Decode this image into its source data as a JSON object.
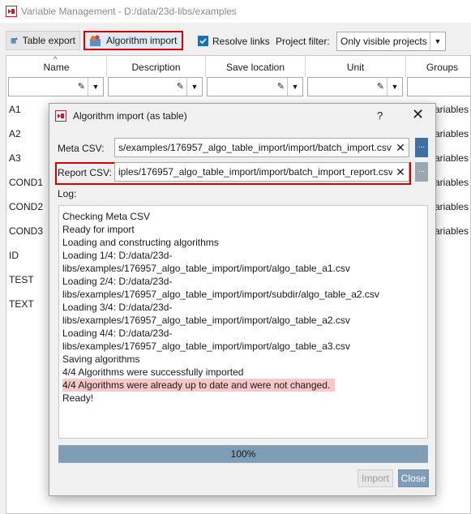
{
  "window": {
    "title": "Variable Management - D:/data/23d-libs/examples"
  },
  "toolbar": {
    "table_export_label": "Table export",
    "algorithm_import_label": "Algorithm import",
    "resolve_links_label": "Resolve links",
    "resolve_links_checked": true,
    "project_filter_label": "Project filter:",
    "project_filter_value": "Only visible projects"
  },
  "table": {
    "columns": [
      "Name",
      "Description",
      "Save location",
      "Unit",
      "Groups"
    ],
    "rows": [
      {
        "name": "A1",
        "groups": "ariables"
      },
      {
        "name": "A2",
        "groups": "ariables"
      },
      {
        "name": "A3",
        "groups": "ariables"
      },
      {
        "name": "COND1",
        "groups": "ariables"
      },
      {
        "name": "COND2",
        "groups": "ariables"
      },
      {
        "name": "COND3",
        "groups": "ariables"
      },
      {
        "name": "ID",
        "groups": ""
      },
      {
        "name": "TEST",
        "groups": ""
      },
      {
        "name": "TEXT",
        "groups": ""
      }
    ]
  },
  "dialog": {
    "title": "Algorithm import (as table)",
    "help": "?",
    "meta_csv_label": "Meta CSV:",
    "meta_csv_value": "s/examples/176957_algo_table_import/import/batch_import.csv",
    "report_csv_label": "Report CSV:",
    "report_csv_value": "iples/176957_algo_table_import/import/batch_import_report.csv",
    "browse_label": "...",
    "log_label": "Log:",
    "log_lines": [
      "Checking Meta CSV",
      "Ready for import",
      "Loading and constructing algorithms",
      "Loading 1/4: D:/data/23d-",
      "libs/examples/176957_algo_table_import/import/algo_table_a1.csv",
      "Loading 2/4: D:/data/23d-",
      "libs/examples/176957_algo_table_import/import/subdir/algo_table_a2.csv",
      "Loading 3/4: D:/data/23d-",
      "libs/examples/176957_algo_table_import/import/algo_table_a2.csv",
      "Loading 4/4: D:/data/23d-",
      "libs/examples/176957_algo_table_import/import/algo_table_a3.csv",
      "Saving algorithms",
      "4/4 Algorithms were successfully imported",
      "4/4 Algorithms were already up to date and were not changed.",
      "Ready!"
    ],
    "highlighted_log_line": 13,
    "progress_percent": 100,
    "progress_text": "100%",
    "import_label": "Import",
    "close_label": "Close"
  },
  "colors": {
    "accent": "#7f9db7",
    "highlight_border": "#d40000",
    "log_highlight": "#f8c8c8",
    "browse_button": "#3f6fa3"
  }
}
